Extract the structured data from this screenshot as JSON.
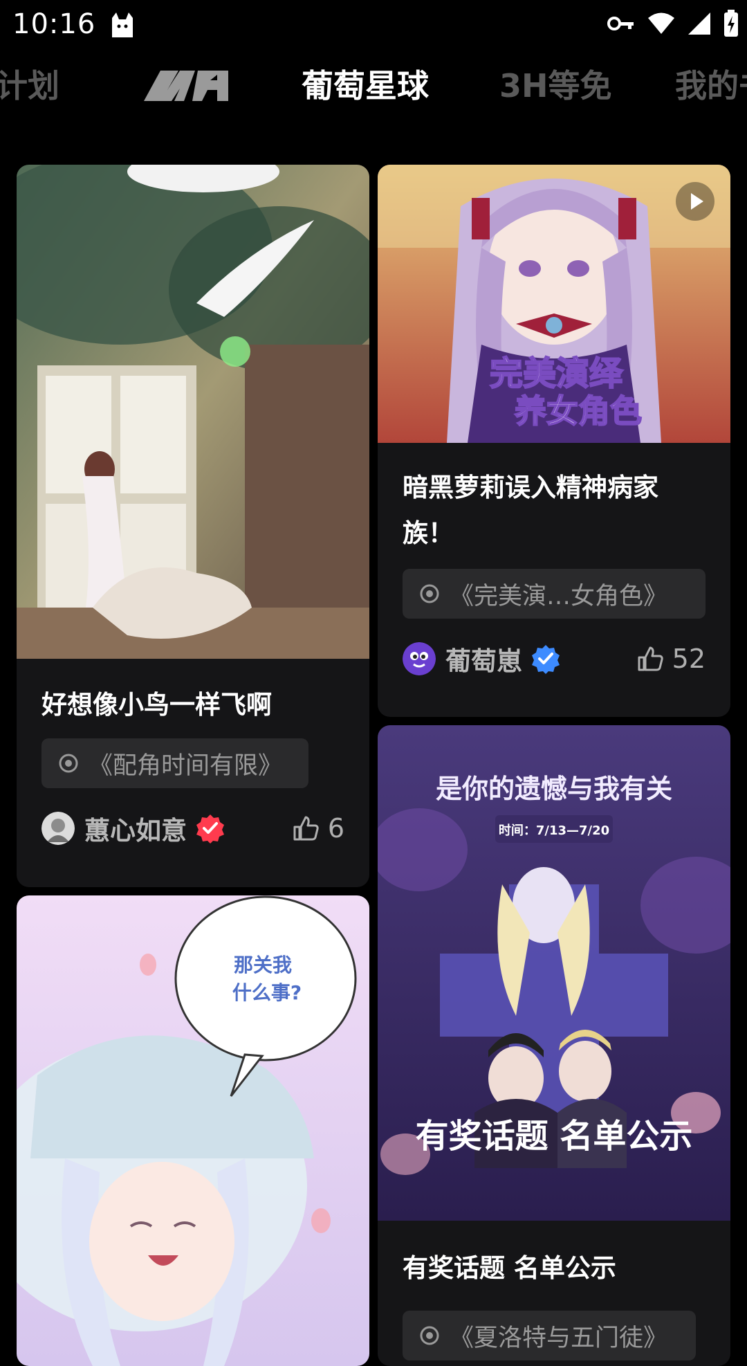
{
  "status_bar": {
    "time": "10:16"
  },
  "tabs": [
    {
      "label": "计划",
      "active": false
    },
    {
      "label": "葡萄星球",
      "active": true
    },
    {
      "label": "3H等免",
      "active": false
    },
    {
      "label": "我的书",
      "active": false
    }
  ],
  "cards": [
    {
      "title": "好想像小鸟一样飞啊",
      "work": "《配角时间有限》",
      "author": "蕙心如意",
      "likes": "6"
    },
    {
      "title_line1": "暗黑萝莉误入精神病家",
      "title_line2": "族！",
      "work": "《完美演…女角色》",
      "author": "葡萄崽",
      "likes": "52",
      "cover_text_line1": "完美演绎",
      "cover_text_line2": "养女角色"
    },
    {
      "title": "有奖话题 名单公示",
      "work": "《夏洛特与五门徒》",
      "cover_headline": "是你的遗憾与我有关",
      "cover_date": "时间：7/13—7/20",
      "cover_footer": "有奖话题  名单公示"
    },
    {
      "bubble_line1": "那关我",
      "bubble_line2": "什么事?"
    }
  ],
  "colors": {
    "background": "#000000",
    "card": "#151517",
    "chip": "#2a2a2c",
    "verify_red": "#ff3b4e",
    "verify_blue": "#3d8bff"
  }
}
